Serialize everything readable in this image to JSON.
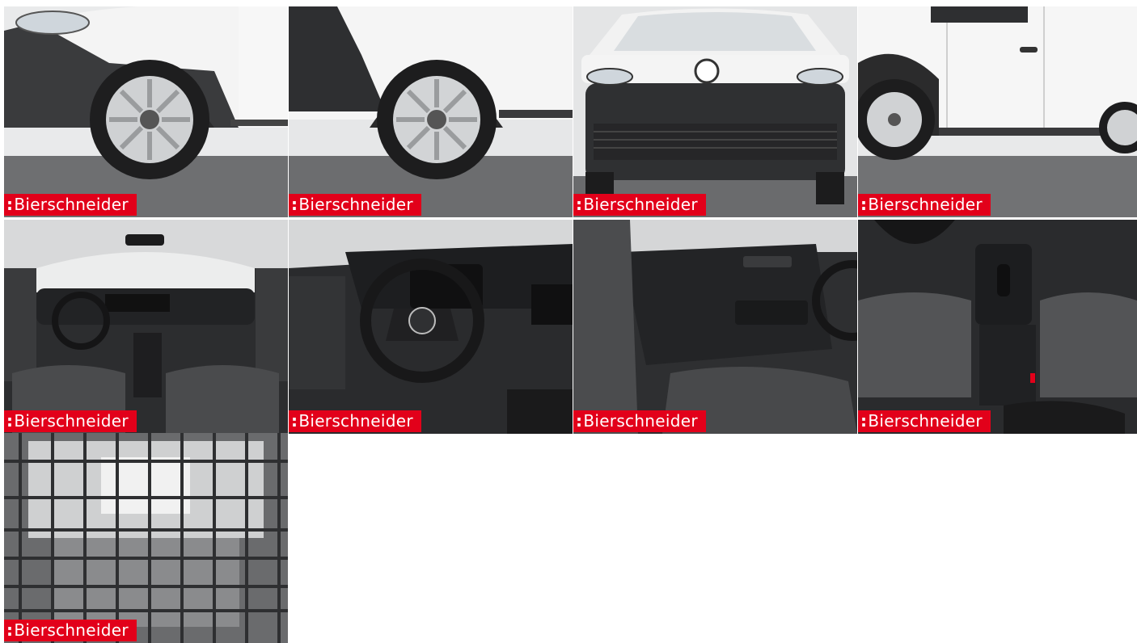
{
  "gallery": {
    "watermark": "Bierschneider",
    "watermark_mark": ":",
    "brand_color": "#e2001a",
    "photos": [
      {
        "subject": "front-wheel-closeup",
        "caption": "Bierschneider"
      },
      {
        "subject": "rear-wheel-closeup",
        "caption": "Bierschneider"
      },
      {
        "subject": "front-view",
        "caption": "Bierschneider"
      },
      {
        "subject": "side-view",
        "caption": "Bierschneider"
      },
      {
        "subject": "cockpit-overview",
        "caption": "Bierschneider"
      },
      {
        "subject": "steering-wheel",
        "caption": "Bierschneider"
      },
      {
        "subject": "driver-door-panel",
        "caption": "Bierschneider"
      },
      {
        "subject": "center-console-seats",
        "caption": "Bierschneider"
      },
      {
        "subject": "cargo-partition-grille",
        "caption": "Bierschneider"
      }
    ]
  }
}
